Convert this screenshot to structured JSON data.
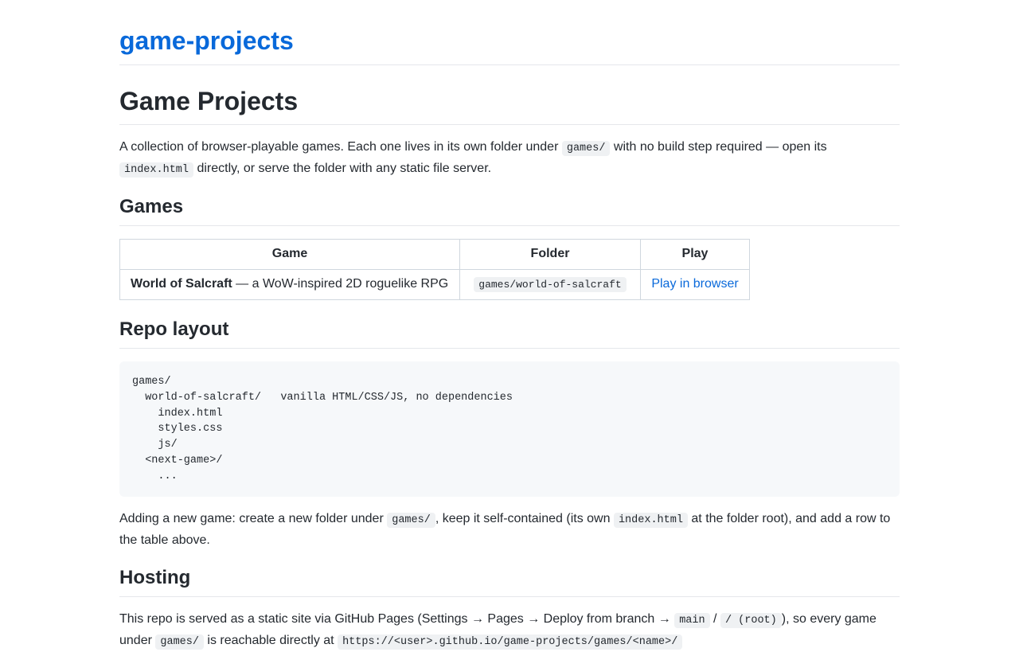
{
  "site": {
    "title": "game-projects"
  },
  "page": {
    "title": "Game Projects"
  },
  "intro": {
    "t1": "A collection of browser-playable games. Each one lives in its own folder under ",
    "c1": "games/",
    "t2": " with no build step required — open its ",
    "c2": "index.html",
    "t3": " directly, or serve the folder with any static file server."
  },
  "games": {
    "heading": "Games",
    "columns": [
      "Game",
      "Folder",
      "Play"
    ],
    "rows": [
      {
        "name": "World of Salcraft",
        "desc": " — a WoW-inspired 2D roguelike RPG",
        "folder": "games/world-of-salcraft",
        "play": "Play in browser"
      }
    ]
  },
  "layout": {
    "heading": "Repo layout",
    "code": "games/\n  world-of-salcraft/   vanilla HTML/CSS/JS, no dependencies\n    index.html\n    styles.css\n    js/\n  <next-game>/\n    ..."
  },
  "adding": {
    "t1": "Adding a new game: create a new folder under ",
    "c1": "games/",
    "t2": ", keep it self-contained (its own ",
    "c2": "index.html",
    "t3": " at the folder root), and add a row to the table above."
  },
  "hosting": {
    "heading": "Hosting",
    "t1": "This repo is served as a static site via GitHub Pages (Settings → Pages → Deploy from branch → ",
    "c1": "main",
    "t2": " / ",
    "c2": "/ (root)",
    "t3": "), so every game under ",
    "c3": "games/",
    "t4": " is reachable directly at ",
    "c4": "https://<user>.github.io/game-projects/games/<name>/"
  }
}
